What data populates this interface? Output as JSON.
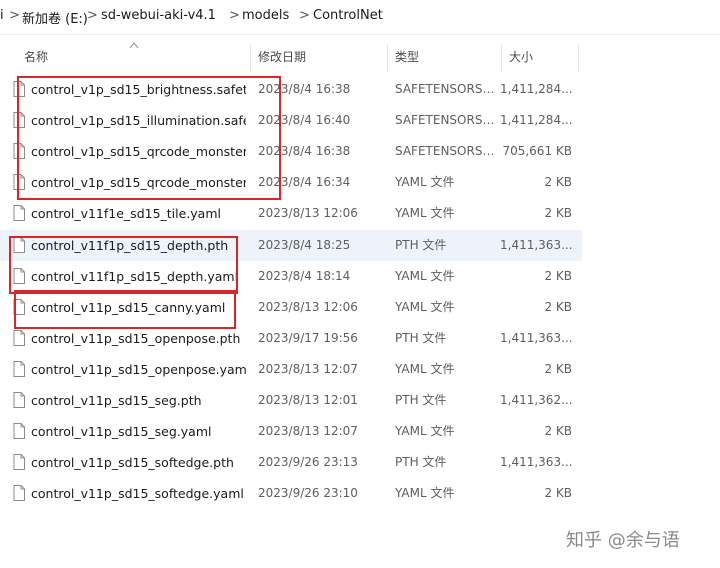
{
  "breadcrumb": {
    "items": [
      "i",
      "新加卷 (E:)",
      "sd-webui-aki-v4.1",
      "models",
      "ControlNet"
    ],
    "separator": ">"
  },
  "columns": {
    "name": "名称",
    "date": "修改日期",
    "type": "类型",
    "size": "大小"
  },
  "files": [
    {
      "name": "control_v1p_sd15_brightness.safeten...",
      "date": "2023/8/4 16:38",
      "type": "SAFETENSORS ...",
      "size": "1,411,284..."
    },
    {
      "name": "control_v1p_sd15_illumination.safete...",
      "date": "2023/8/4 16:40",
      "type": "SAFETENSORS ...",
      "size": "1,411,284..."
    },
    {
      "name": "control_v1p_sd15_qrcode_monster.s...",
      "date": "2023/8/4 16:38",
      "type": "SAFETENSORS ...",
      "size": "705,661 KB"
    },
    {
      "name": "control_v1p_sd15_qrcode_monster.y...",
      "date": "2023/8/4 16:34",
      "type": "YAML 文件",
      "size": "2 KB"
    },
    {
      "name": "control_v11f1e_sd15_tile.yaml",
      "date": "2023/8/13 12:06",
      "type": "YAML 文件",
      "size": "2 KB"
    },
    {
      "name": "control_v11f1p_sd15_depth.pth",
      "date": "2023/8/4 18:25",
      "type": "PTH 文件",
      "size": "1,411,363..."
    },
    {
      "name": "control_v11f1p_sd15_depth.yaml",
      "date": "2023/8/4 18:14",
      "type": "YAML 文件",
      "size": "2 KB"
    },
    {
      "name": "control_v11p_sd15_canny.yaml",
      "date": "2023/8/13 12:06",
      "type": "YAML 文件",
      "size": "2 KB"
    },
    {
      "name": "control_v11p_sd15_openpose.pth",
      "date": "2023/9/17 19:56",
      "type": "PTH 文件",
      "size": "1,411,363..."
    },
    {
      "name": "control_v11p_sd15_openpose.yaml",
      "date": "2023/8/13 12:07",
      "type": "YAML 文件",
      "size": "2 KB"
    },
    {
      "name": "control_v11p_sd15_seg.pth",
      "date": "2023/8/13 12:01",
      "type": "PTH 文件",
      "size": "1,411,362..."
    },
    {
      "name": "control_v11p_sd15_seg.yaml",
      "date": "2023/8/13 12:07",
      "type": "YAML 文件",
      "size": "2 KB"
    },
    {
      "name": "control_v11p_sd15_softedge.pth",
      "date": "2023/9/26 23:13",
      "type": "PTH 文件",
      "size": "1,411,363..."
    },
    {
      "name": "control_v11p_sd15_softedge.yaml",
      "date": "2023/9/26 23:10",
      "type": "YAML 文件",
      "size": "2 KB"
    }
  ],
  "selected_file_index": 5,
  "watermark": "知乎 @余与语",
  "colors": {
    "highlight_box": "#d9262a",
    "selected_row": "#eef3fb"
  },
  "icons": {
    "file": "document-icon",
    "sort": "sort-ascending-icon"
  }
}
